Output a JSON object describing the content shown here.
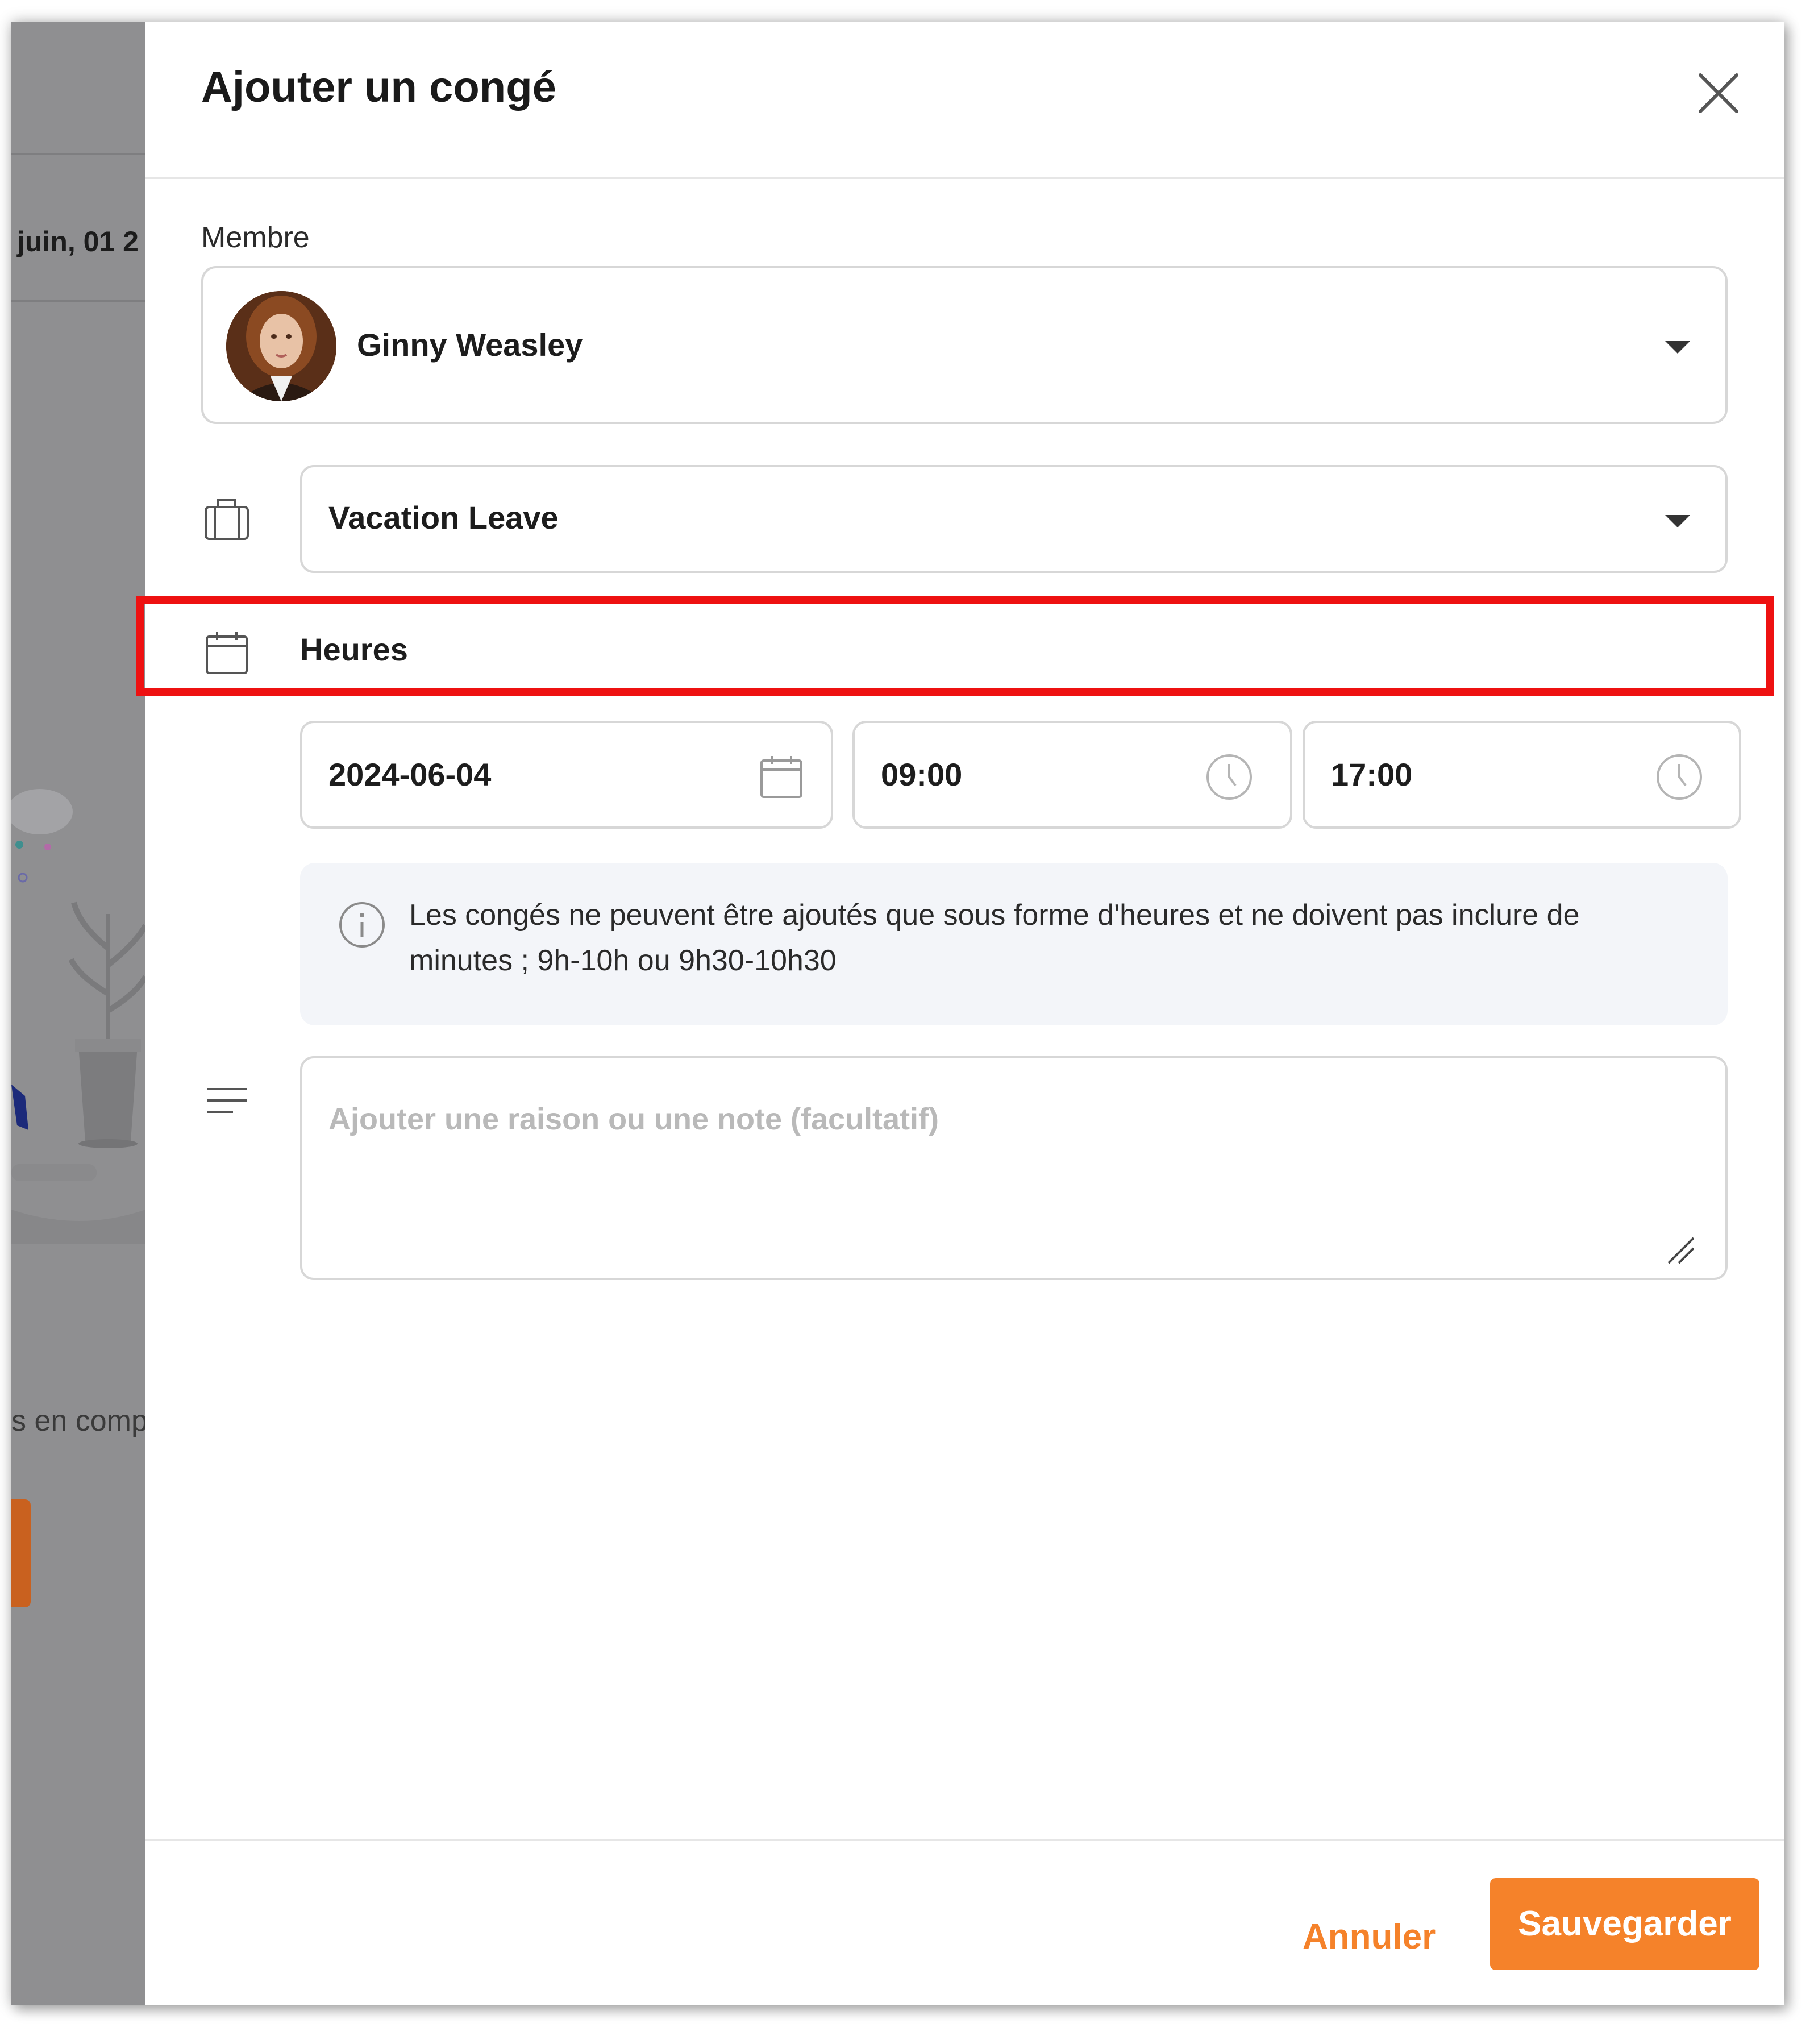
{
  "background": {
    "date_fragment": "juin, 01 2",
    "text_fragment": "s en comp"
  },
  "modal": {
    "title": "Ajouter un congé",
    "member_label": "Membre",
    "member_name": "Ginny Weasley",
    "leave_type": "Vacation Leave",
    "duration_mode": "Heures",
    "date_value": "2024-06-04",
    "start_time": "09:00",
    "end_time": "17:00",
    "info_text": "Les congés ne peuvent être ajoutés que sous forme d'heures et ne doivent pas inclure de minutes ; 9h-10h ou 9h30-10h30",
    "note_placeholder": "Ajouter une raison ou une note (facultatif)",
    "cancel_label": "Annuler",
    "save_label": "Sauvegarder"
  },
  "colors": {
    "accent": "#f5822a",
    "highlight": "#ee1111",
    "border": "#d7d7d7",
    "info_bg": "#f3f5f9"
  },
  "icons": [
    "close-icon",
    "chevron-down-icon",
    "briefcase-icon",
    "calendar-icon",
    "clock-icon",
    "info-icon",
    "lines-icon",
    "resize-handle-icon"
  ]
}
